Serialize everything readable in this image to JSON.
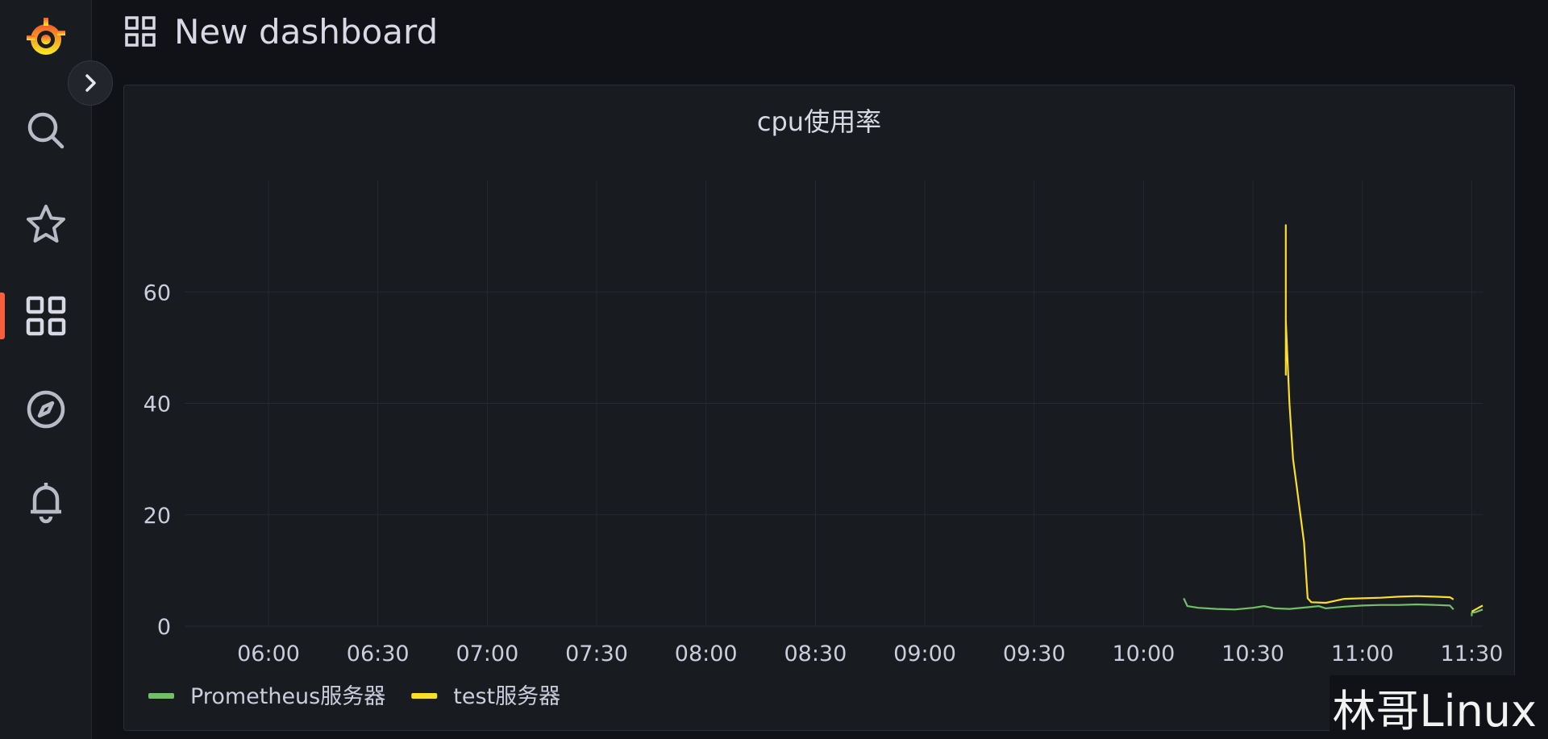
{
  "header": {
    "title": "New dashboard"
  },
  "sidebar": {
    "items": [
      {
        "icon": "grafana-logo-icon"
      },
      {
        "icon": "search-icon"
      },
      {
        "icon": "star-icon"
      },
      {
        "icon": "dashboards-icon",
        "active": true
      },
      {
        "icon": "explore-compass-icon"
      },
      {
        "icon": "alerting-bell-icon"
      }
    ],
    "accent": "#f55f3e"
  },
  "panel": {
    "title": "cpu使用率"
  },
  "watermark": "林哥Linux",
  "chart_data": {
    "type": "line",
    "title": "cpu使用率",
    "x_ticks": [
      "06:00",
      "06:30",
      "07:00",
      "07:30",
      "08:00",
      "08:30",
      "09:00",
      "09:30",
      "10:00",
      "10:30",
      "11:00",
      "11:30"
    ],
    "y_ticks": [
      0,
      20,
      40,
      60
    ],
    "ylim": [
      0,
      80
    ],
    "xlim": [
      "05:37",
      "11:33"
    ],
    "grid": true,
    "legend_position": "bottom-left",
    "series": [
      {
        "name": "Prometheus服务器",
        "color": "#73bf69",
        "points": [
          [
            "10:11",
            5.0
          ],
          [
            "10:12",
            3.6
          ],
          [
            "10:15",
            3.3
          ],
          [
            "10:20",
            3.1
          ],
          [
            "10:25",
            3.0
          ],
          [
            "10:30",
            3.3
          ],
          [
            "10:33",
            3.6
          ],
          [
            "10:36",
            3.2
          ],
          [
            "10:40",
            3.1
          ],
          [
            "10:45",
            3.4
          ],
          [
            "10:48",
            3.6
          ],
          [
            "10:50",
            3.2
          ],
          [
            "10:55",
            3.5
          ],
          [
            "11:00",
            3.7
          ],
          [
            "11:05",
            3.8
          ],
          [
            "11:10",
            3.8
          ],
          [
            "11:15",
            3.9
          ],
          [
            "11:20",
            3.8
          ],
          [
            "11:24",
            3.7
          ],
          [
            "11:25",
            3.0
          ],
          null,
          [
            "11:30",
            1.8
          ],
          [
            "11:30",
            2.4
          ],
          [
            "11:31",
            2.5
          ],
          [
            "11:33",
            3.0
          ]
        ]
      },
      {
        "name": "test服务器",
        "color": "#fade2a",
        "points": [
          [
            "10:39",
            45
          ],
          [
            "10:39",
            72
          ],
          [
            "10:39",
            55
          ],
          [
            "10:40",
            40
          ],
          [
            "10:41",
            30
          ],
          [
            "10:42",
            25
          ],
          [
            "10:43",
            20
          ],
          [
            "10:44",
            15
          ],
          [
            "10:45",
            5.0
          ],
          [
            "10:46",
            4.3
          ],
          [
            "10:50",
            4.2
          ],
          [
            "10:55",
            4.9
          ],
          [
            "11:00",
            5.0
          ],
          [
            "11:05",
            5.1
          ],
          [
            "11:10",
            5.3
          ],
          [
            "11:15",
            5.4
          ],
          [
            "11:20",
            5.3
          ],
          [
            "11:24",
            5.2
          ],
          [
            "11:25",
            4.8
          ],
          null,
          [
            "11:30",
            2.6
          ],
          [
            "11:31",
            3.0
          ],
          [
            "11:33",
            3.7
          ]
        ]
      }
    ]
  }
}
